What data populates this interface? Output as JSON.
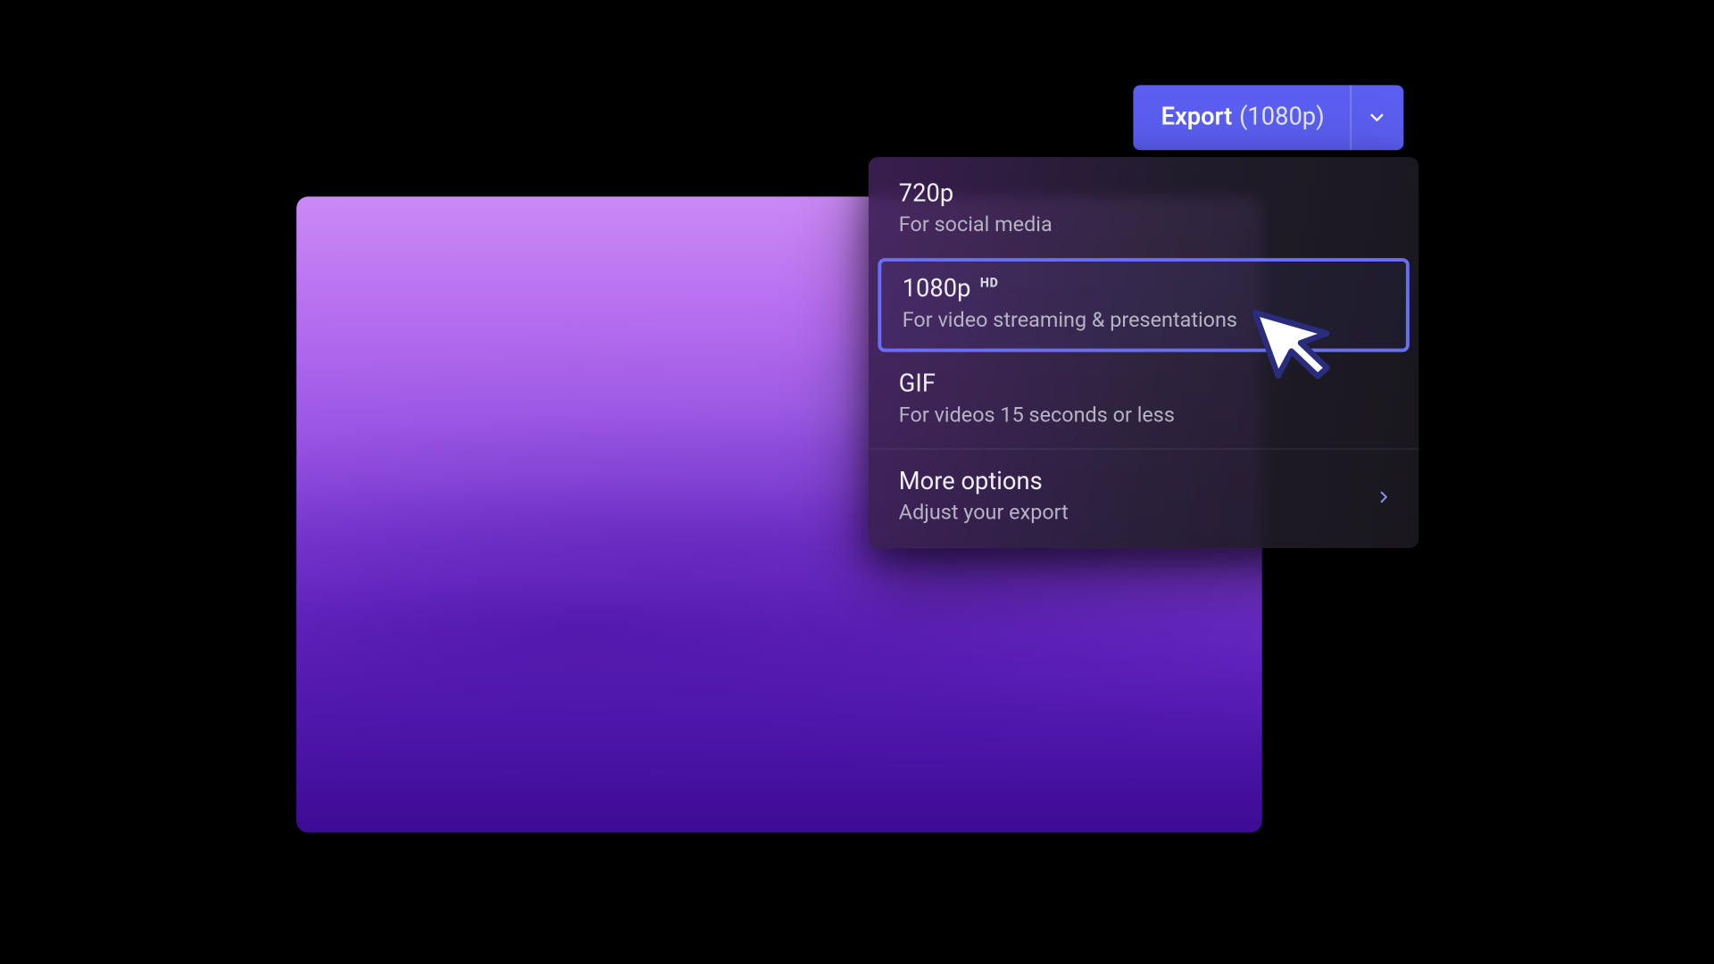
{
  "colors": {
    "accent": "#5b5ff1",
    "accentBorder": "#6a6ef6"
  },
  "export": {
    "label": "Export",
    "resolution": "(1080p)"
  },
  "menu": {
    "items": [
      {
        "title": "720p",
        "badge": "",
        "sub": "For social media",
        "selected": false
      },
      {
        "title": "1080p",
        "badge": "HD",
        "sub": "For video streaming & presentations",
        "selected": true
      },
      {
        "title": "GIF",
        "badge": "",
        "sub": "For videos 15 seconds or less",
        "selected": false
      }
    ],
    "more": {
      "title": "More options",
      "sub": "Adjust your export"
    }
  }
}
